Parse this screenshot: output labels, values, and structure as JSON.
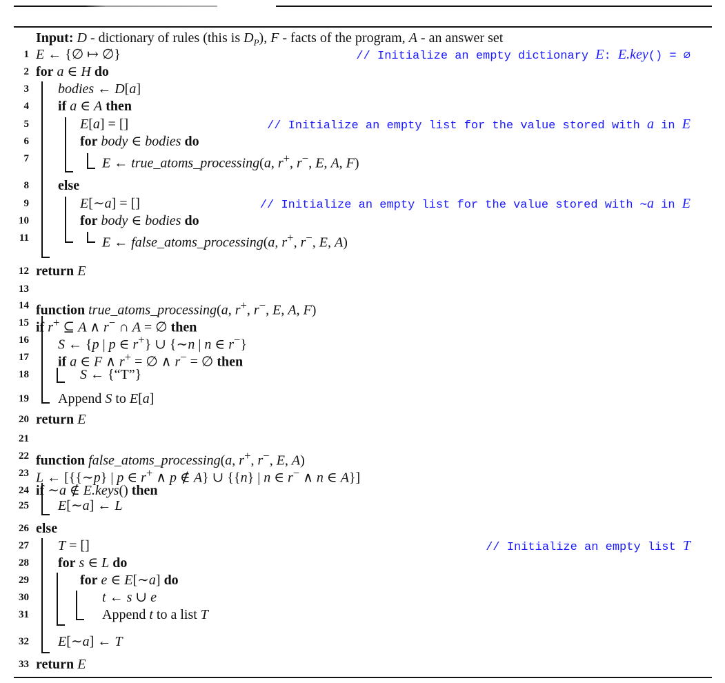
{
  "input": {
    "label": "Input:",
    "text": "D - dictionary of rules (this is D_P), F - facts of the program, A - an answer set",
    "html": "<span class='i'>D</span> - dictionary of rules (this is <span class='i'>D<sub style='font-size:13px'>P</sub></span>), <span class='i'>F</span> - facts of the program, <span class='i'>A</span> - an answer set"
  },
  "accent_color": "#1a1aff",
  "lines": [
    {
      "n": "1",
      "indent": 0,
      "code": "<span class='i'>E</span> ← {∅ ↦ ∅}",
      "comment": "// Initialize an empty dictionary <span class='m'>E</span>:  <span class='m'>E.key</span>() = ∅"
    },
    {
      "n": "2",
      "indent": 0,
      "code": "<span class='kw'>for</span> <span class='i'>a</span> ∈ <span class='i'>H</span> <span class='kw'>do</span>"
    },
    {
      "n": "3",
      "indent": 1,
      "code": "<span class='i'>bodies</span> ← <span class='i'>D</span>[<span class='i'>a</span>]"
    },
    {
      "n": "4",
      "indent": 1,
      "code": "<span class='kw'>if</span> <span class='i'>a</span> ∈ <span class='i'>A</span> <span class='kw'>then</span>"
    },
    {
      "n": "5",
      "indent": 2,
      "code": "<span class='i'>E</span>[<span class='i'>a</span>] = []",
      "comment": "// Initialize an empty list for the value stored with <span class='m'>a</span> in <span class='m'>E</span>"
    },
    {
      "n": "6",
      "indent": 2,
      "code": "<span class='kw'>for</span> <span class='i'>body</span> ∈ <span class='i'>bodies</span> <span class='kw'>do</span>"
    },
    {
      "n": "7",
      "indent": 3,
      "code": "<span class='i'>E</span> ← <span class='i'>true_atoms_processing</span>(<span class='i'>a</span>, <span class='i'>r</span><sup>+</sup>, <span class='i'>r</span><sup>−</sup>, <span class='i'>E</span>, <span class='i'>A</span>, <span class='i'>F</span>)"
    },
    {
      "n": "8",
      "indent": 1,
      "code": "<span class='kw'>else</span>"
    },
    {
      "n": "9",
      "indent": 2,
      "code": "<span class='i'>E</span>[∼<span class='i'>a</span>] = []",
      "comment": "// Initialize an empty list for the value stored with ∼<span class='m'>a</span> in <span class='m'>E</span>"
    },
    {
      "n": "10",
      "indent": 2,
      "code": "<span class='kw'>for</span> <span class='i'>body</span> ∈ <span class='i'>bodies</span> <span class='kw'>do</span>"
    },
    {
      "n": "11",
      "indent": 3,
      "code": "<span class='i'>E</span> ← <span class='i'>false_atoms_processing</span>(<span class='i'>a</span>, <span class='i'>r</span><sup>+</sup>, <span class='i'>r</span><sup>−</sup>, <span class='i'>E</span>, <span class='i'>A</span>)"
    },
    {
      "n": "12",
      "indent": 0,
      "code": "<span class='kw'>return</span> <span class='i'>E</span>"
    },
    {
      "n": "13",
      "indent": 0,
      "code": ""
    },
    {
      "n": "14",
      "indent": 0,
      "code": "<span class='kw'>function</span> <span class='i'>true_atoms_processing</span>(<span class='i'>a</span>, <span class='i'>r</span><sup>+</sup>, <span class='i'>r</span><sup>−</sup>, <span class='i'>E</span>, <span class='i'>A</span>, <span class='i'>F</span>)"
    },
    {
      "n": "15",
      "indent": 0,
      "code": "<span class='kw'>if</span> <span class='i'>r</span><sup>+</sup> ⊆ <span class='i'>A</span> ∧ <span class='i'>r</span><sup>−</sup> ∩ <span class='i'>A</span> = ∅ <span class='kw'>then</span>"
    },
    {
      "n": "16",
      "indent": 1,
      "code": "<span class='i'>S</span> ← {<span class='i'>p</span> | <span class='i'>p</span> ∈ <span class='i'>r</span><sup>+</sup>} ∪ {∼<span class='i'>n</span> | <span class='i'>n</span> ∈ <span class='i'>r</span><sup>−</sup>}"
    },
    {
      "n": "17",
      "indent": 1,
      "code": "<span class='kw'>if</span> <span class='i'>a</span> ∈ <span class='i'>F</span> ∧ <span class='i'>r</span><sup>+</sup> = ∅ ∧ <span class='i'>r</span><sup>−</sup> = ∅ <span class='kw'>then</span>"
    },
    {
      "n": "18",
      "indent": 2,
      "code": "<span class='i'>S</span> ← {“T”}"
    },
    {
      "n": "19",
      "indent": 1,
      "code": "Append <span class='i'>S</span> to <span class='i'>E</span>[<span class='i'>a</span>]"
    },
    {
      "n": "20",
      "indent": 0,
      "code": "<span class='kw'>return</span> <span class='i'>E</span>"
    },
    {
      "n": "21",
      "indent": 0,
      "code": ""
    },
    {
      "n": "22",
      "indent": 0,
      "code": "<span class='kw'>function</span> <span class='i'>false_atoms_processing</span>(<span class='i'>a</span>, <span class='i'>r</span><sup>+</sup>, <span class='i'>r</span><sup>−</sup>, <span class='i'>E</span>, <span class='i'>A</span>)"
    },
    {
      "n": "23",
      "indent": 0,
      "code": "<span class='i'>L</span> ← [{{∼<span class='i'>p</span>} | <span class='i'>p</span> ∈ <span class='i'>r</span><sup>+</sup> ∧ <span class='i'>p</span> ∉ <span class='i'>A</span>} ∪ {{<span class='i'>n</span>} | <span class='i'>n</span> ∈ <span class='i'>r</span><sup>−</sup> ∧ <span class='i'>n</span> ∈ <span class='i'>A</span>}]"
    },
    {
      "n": "24",
      "indent": 0,
      "code": "<span class='kw'>if</span> ∼<span class='i'>a</span> ∉ <span class='i'>E.keys</span>() <span class='kw'>then</span>"
    },
    {
      "n": "25",
      "indent": 1,
      "code": "<span class='i'>E</span>[∼<span class='i'>a</span>] ← <span class='i'>L</span>"
    },
    {
      "n": "26",
      "indent": 0,
      "code": "<span class='kw'>else</span>"
    },
    {
      "n": "27",
      "indent": 1,
      "code": "<span class='i'>T</span> = []",
      "comment": "// Initialize an empty list <span class='m'>T</span>"
    },
    {
      "n": "28",
      "indent": 1,
      "code": "<span class='kw'>for</span> <span class='i'>s</span> ∈ <span class='i'>L</span> <span class='kw'>do</span>"
    },
    {
      "n": "29",
      "indent": 2,
      "code": "<span class='kw'>for</span> <span class='i'>e</span> ∈ <span class='i'>E</span>[∼<span class='i'>a</span>] <span class='kw'>do</span>"
    },
    {
      "n": "30",
      "indent": 3,
      "code": "<span class='i'>t</span> ← <span class='i'>s</span> ∪ <span class='i'>e</span>"
    },
    {
      "n": "31",
      "indent": 3,
      "code": "Append <span class='i'>t</span> to a list <span class='i'>T</span>"
    },
    {
      "n": "32",
      "indent": 1,
      "code": "<span class='i'>E</span>[∼<span class='i'>a</span>] ← <span class='i'>T</span>"
    },
    {
      "n": "33",
      "indent": 0,
      "code": "<span class='kw'>return</span> <span class='i'>E</span>"
    }
  ]
}
